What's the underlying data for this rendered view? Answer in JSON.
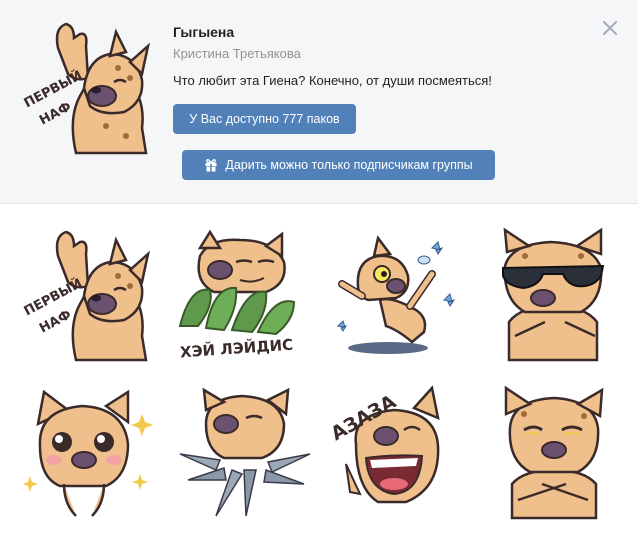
{
  "pack": {
    "title": "Гыгыена",
    "author": "Кристина Третьякова",
    "description": "Что любит эта Гиена? Конечно, от души посмеяться!",
    "preview_caption_line1": "ПЕРВЫЙ",
    "preview_caption_line2": "НАФ"
  },
  "buttons": {
    "packs_label": "У Вас доступно 777 паков",
    "gift_label": "Дарить можно только подписчикам группы",
    "gift_icon": "gift-icon",
    "close_icon": "close-icon"
  },
  "stickers": {
    "s1_line1": "ПЕРВЫЙ",
    "s1_line2": "НАФ",
    "s2_caption": "ХЭЙ ЛЭЙДИС",
    "s7_caption": "АЗАЗА"
  },
  "colors": {
    "accent": "#5181b8",
    "header_bg": "#f5f6f8",
    "fur": "#f0c08c",
    "snout": "#6b5070"
  }
}
